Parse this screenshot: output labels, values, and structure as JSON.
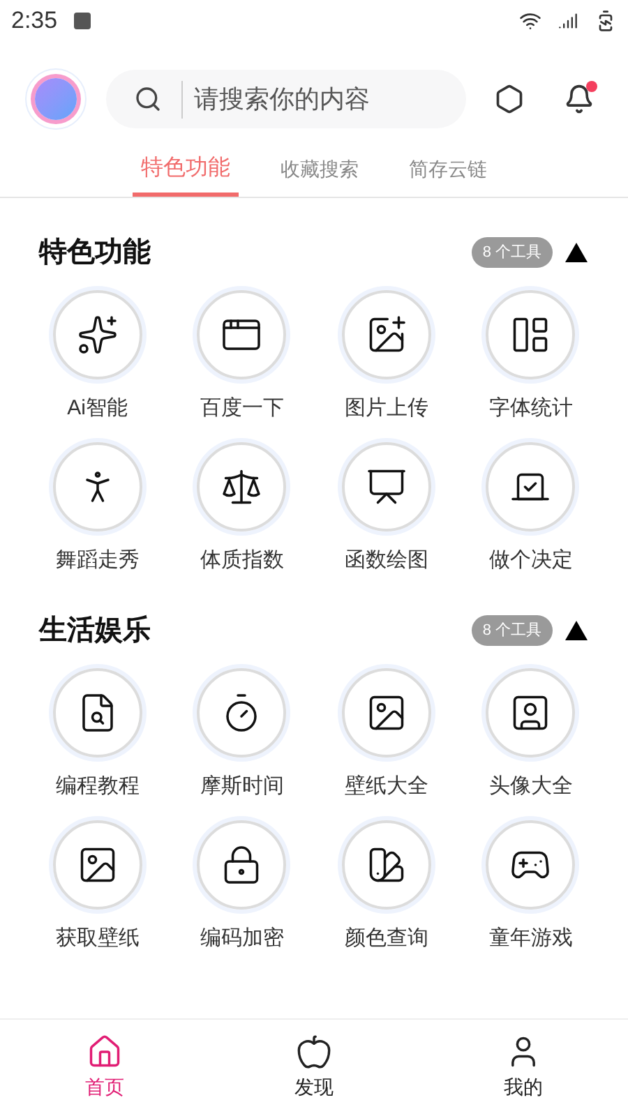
{
  "status_bar": {
    "time": "2:35"
  },
  "header": {
    "search": {
      "placeholder": "请搜索你的内容"
    },
    "notifications": {
      "unread": true
    }
  },
  "tabs": [
    {
      "label": "特色功能",
      "selected": true
    },
    {
      "label": "收藏搜索",
      "selected": false
    },
    {
      "label": "简存云链",
      "selected": false
    }
  ],
  "sections": [
    {
      "title": "特色功能",
      "badge": "8 个工具",
      "expanded": true,
      "tools": [
        {
          "label": "Ai智能"
        },
        {
          "label": "百度一下"
        },
        {
          "label": "图片上传"
        },
        {
          "label": "字体统计"
        },
        {
          "label": "舞蹈走秀"
        },
        {
          "label": "体质指数"
        },
        {
          "label": "函数绘图"
        },
        {
          "label": "做个决定"
        }
      ]
    },
    {
      "title": "生活娱乐",
      "badge": "8 个工具",
      "expanded": true,
      "tools": [
        {
          "label": "编程教程"
        },
        {
          "label": "摩斯时间"
        },
        {
          "label": "壁纸大全"
        },
        {
          "label": "头像大全"
        },
        {
          "label": "获取壁纸"
        },
        {
          "label": "编码加密"
        },
        {
          "label": "颜色查询"
        },
        {
          "label": "童年游戏"
        }
      ]
    }
  ],
  "bottom_nav": [
    {
      "label": "首页",
      "selected": true
    },
    {
      "label": "发现",
      "selected": false
    },
    {
      "label": "我的",
      "selected": false
    }
  ]
}
